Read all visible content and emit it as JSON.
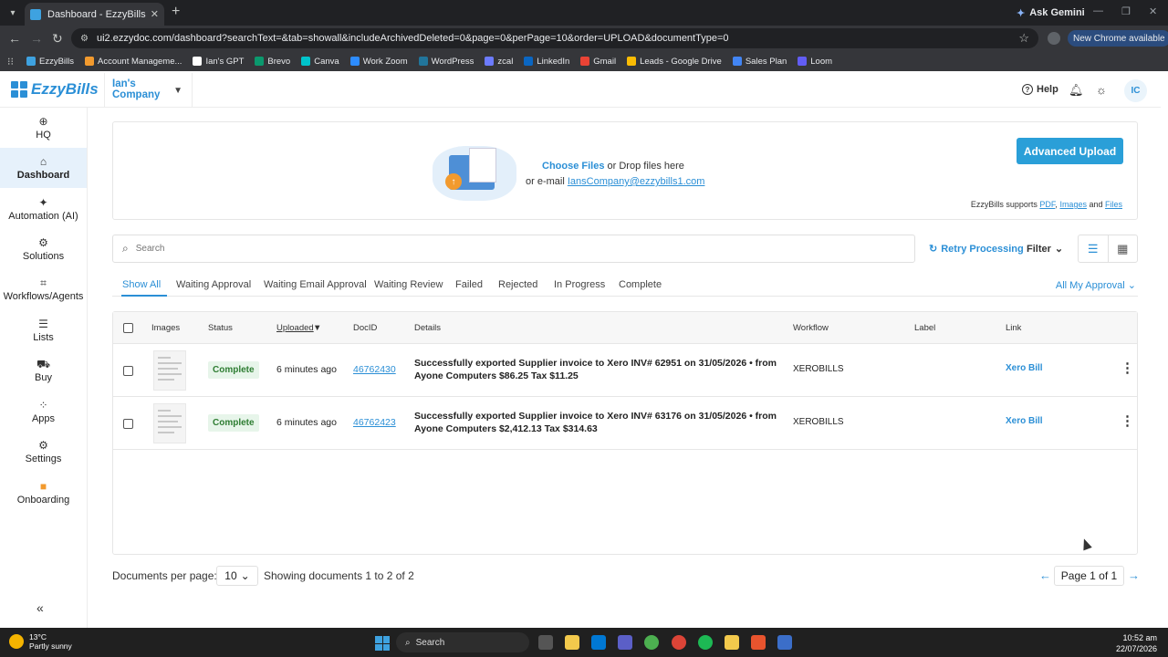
{
  "browser": {
    "tab_title": "Dashboard - EzzyBills",
    "ask_gemini": "Ask Gemini",
    "url": "ui2.ezzydoc.com/dashboard?searchText=&tab=showall&includeArchivedDeleted=0&page=0&perPage=10&order=UPLOAD&documentType=0",
    "new_chrome": "New Chrome available",
    "bookmarks": [
      {
        "label": "EzzyBills",
        "color": "#3ea2e0"
      },
      {
        "label": "Account Manageme...",
        "color": "#f29a2e"
      },
      {
        "label": "Ian's GPT",
        "color": "#ffffff"
      },
      {
        "label": "Brevo",
        "color": "#0b996e"
      },
      {
        "label": "Canva",
        "color": "#00c4cc"
      },
      {
        "label": "Work Zoom",
        "color": "#2d8cff"
      },
      {
        "label": "WordPress",
        "color": "#21759b"
      },
      {
        "label": "zcal",
        "color": "#6c7bff"
      },
      {
        "label": "LinkedIn",
        "color": "#0a66c2"
      },
      {
        "label": "Gmail",
        "color": "#ea4335"
      },
      {
        "label": "Leads - Google Drive",
        "color": "#fbbc04"
      },
      {
        "label": "Sales Plan",
        "color": "#4285f4"
      },
      {
        "label": "Loom",
        "color": "#625df5"
      }
    ]
  },
  "app": {
    "logo": "EzzyBills",
    "company": "Ian's Company",
    "help": "Help",
    "avatar": "IC",
    "accent": "#2b8fd6"
  },
  "sidebar": {
    "items": [
      {
        "label": "HQ",
        "icon": "globe-icon",
        "glyph": "⊕"
      },
      {
        "label": "Dashboard",
        "icon": "home-icon",
        "glyph": "⌂"
      },
      {
        "label": "Automation (AI)",
        "icon": "sparkle-icon",
        "glyph": "✦"
      },
      {
        "label": "Solutions",
        "icon": "solutions-icon",
        "glyph": "⚙"
      },
      {
        "label": "Workflows/Agents",
        "icon": "workflow-icon",
        "glyph": "⌗"
      },
      {
        "label": "Lists",
        "icon": "users-icon",
        "glyph": "☰"
      },
      {
        "label": "Buy",
        "icon": "cart-icon",
        "glyph": "⛟"
      },
      {
        "label": "Apps",
        "icon": "apps-icon",
        "glyph": "⁘"
      },
      {
        "label": "Settings",
        "icon": "gear-icon",
        "glyph": "⚙"
      },
      {
        "label": "Onboarding",
        "icon": "video-icon",
        "glyph": "■"
      }
    ]
  },
  "upload": {
    "choose_files": "Choose Files",
    "drop_text": " or Drop files here",
    "email_prefix": "or e-mail ",
    "email": "IansCompany@ezzybills1.com",
    "advanced_upload": "Advanced Upload",
    "supports_prefix": "EzzyBills supports ",
    "pdf": "PDF",
    "images": "Images",
    "and": " and ",
    "files": "Files"
  },
  "search": {
    "placeholder": "Search",
    "retry": "Retry Processing",
    "filter": "Filter"
  },
  "status_tabs": [
    "Show All",
    "Waiting Approval",
    "Waiting Email Approval",
    "Waiting Review",
    "Failed",
    "Rejected",
    "In Progress",
    "Complete"
  ],
  "approval_filter": "All My Approval",
  "table": {
    "headers": {
      "images": "Images",
      "status": "Status",
      "uploaded": "Uploaded",
      "docid": "DocID",
      "details": "Details",
      "workflow": "Workflow",
      "label": "Label",
      "link": "Link"
    },
    "rows": [
      {
        "status": "Complete",
        "uploaded": "6 minutes ago",
        "docid": "46762430",
        "details": "Successfully exported Supplier invoice to Xero INV# 62951 on 31/05/2026 • from Ayone Computers $86.25 Tax $11.25",
        "workflow": "XEROBILLS",
        "label": "",
        "link": "Xero Bill"
      },
      {
        "status": "Complete",
        "uploaded": "6 minutes ago",
        "docid": "46762423",
        "details": "Successfully exported Supplier invoice to Xero INV# 63176 on 31/05/2026 • from Ayone Computers $2,412.13 Tax $314.63",
        "workflow": "XEROBILLS",
        "label": "",
        "link": "Xero Bill"
      }
    ]
  },
  "pagination": {
    "per_page_label": "Documents per page:",
    "per_page": "10",
    "showing": "Showing documents 1 to 2 of 2",
    "page": "Page 1 of 1"
  },
  "taskbar": {
    "temp": "13°C",
    "weather": "Partly sunny",
    "search": "Search",
    "time": "10:52 am",
    "date": "22/07/2026"
  }
}
